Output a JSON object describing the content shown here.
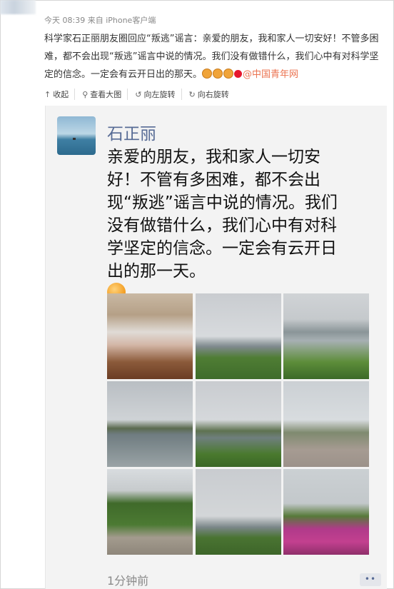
{
  "post": {
    "meta": "今天 08:39 来自 iPhone客户端",
    "text_line1": "科学家石正丽朋友圈回应“叛逃”谣言：亲爱的朋友，我和家人一切安好！不管多困",
    "text_line2": "难，都不会出现“叛逃”谣言中说的情况。我们没有做错什么，我们心中有对科学坚",
    "text_line3": "定的信念。一定会有云开日出的那天。",
    "at_link": "@中国青年网"
  },
  "toolbar": {
    "collapse": "收起",
    "view_large": "查看大图",
    "rotate_left": "向左旋转",
    "rotate_right": "向右旋转"
  },
  "moments": {
    "name": "石正丽",
    "line1": "亲爱的朋友，我和家人一切安",
    "line2": "好！不管有多困难，都不会出",
    "line3": "现“叛逃”谣言中说的情况。我们",
    "line4": "没有做错什么，我们心中有对科",
    "line5": "学坚定的信念。一定会有云开日",
    "line6": "出的那一天。",
    "timestamp": "1分钟前",
    "more": "••"
  }
}
